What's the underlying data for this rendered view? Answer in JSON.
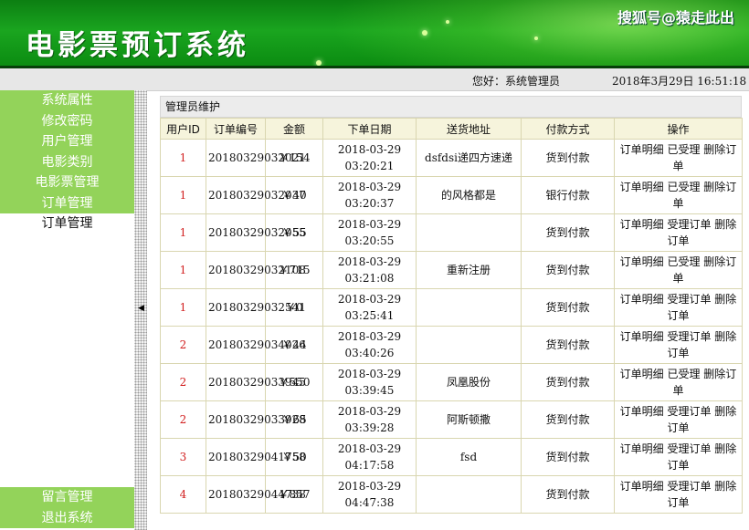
{
  "banner": {
    "title": "电影票预订系统",
    "watermark": "搜狐号@猿走此出"
  },
  "status": {
    "greeting": "您好：系统管理员",
    "datetime": "2018年3月29日 16:51:18"
  },
  "sidebar": {
    "items": [
      {
        "label": "系统属性"
      },
      {
        "label": "修改密码"
      },
      {
        "label": "用户管理"
      },
      {
        "label": "电影类别"
      },
      {
        "label": "电影票管理"
      },
      {
        "label": "订单管理"
      },
      {
        "label": "订单管理"
      }
    ],
    "bottom_items": [
      {
        "label": "留言管理"
      },
      {
        "label": "退出系统"
      }
    ]
  },
  "main": {
    "section_title": "管理员维护",
    "columns": [
      "用户ID",
      "订单编号",
      "金额",
      "下单日期",
      "送货地址",
      "付款方式",
      "操作"
    ],
    "rows": [
      {
        "uid": "1",
        "order_no": "20180329032021",
        "amount": "￥154",
        "date": "2018-03-29 03:20:21",
        "address": "dsfdsi递四方速递",
        "payment": "货到付款",
        "ops": "订单明细 已受理 删除订单"
      },
      {
        "uid": "1",
        "order_no": "20180329032037",
        "amount": "￥40",
        "date": "2018-03-29 03:20:37",
        "address": "的风格都是",
        "payment": "银行付款",
        "ops": "订单明细 已受理 删除订单"
      },
      {
        "uid": "1",
        "order_no": "20180329032055",
        "amount": "￥55",
        "date": "2018-03-29 03:20:55",
        "address": "",
        "payment": "货到付款",
        "ops": "订单明细 受理订单 删除订单"
      },
      {
        "uid": "1",
        "order_no": "20180329032108",
        "amount": "￥715",
        "date": "2018-03-29 03:21:08",
        "address": "重新注册",
        "payment": "货到付款",
        "ops": "订单明细 已受理 删除订单"
      },
      {
        "uid": "1",
        "order_no": "20180329032541",
        "amount": "￥0",
        "date": "2018-03-29 03:25:41",
        "address": "",
        "payment": "货到付款",
        "ops": "订单明细 受理订单 删除订单"
      },
      {
        "uid": "2",
        "order_no": "20180329034026",
        "amount": "￥44",
        "date": "2018-03-29 03:40:26",
        "address": "",
        "payment": "货到付款",
        "ops": "订单明细 受理订单 删除订单"
      },
      {
        "uid": "2",
        "order_no": "20180329033945",
        "amount": "￥550",
        "date": "2018-03-29 03:39:45",
        "address": "凤凰股份",
        "payment": "货到付款",
        "ops": "订单明细 已受理 删除订单"
      },
      {
        "uid": "2",
        "order_no": "20180329033928",
        "amount": "￥65",
        "date": "2018-03-29 03:39:28",
        "address": "阿斯顿撒",
        "payment": "货到付款",
        "ops": "订单明细 受理订单 删除订单"
      },
      {
        "uid": "3",
        "order_no": "20180329041758",
        "amount": "￥50",
        "date": "2018-03-29 04:17:58",
        "address": "fsd",
        "payment": "货到付款",
        "ops": "订单明细 受理订单 删除订单"
      },
      {
        "uid": "4",
        "order_no": "20180329044738",
        "amount": "￥857",
        "date": "2018-03-29 04:47:38",
        "address": "",
        "payment": "货到付款",
        "ops": "订单明细 受理订单 删除订单"
      }
    ]
  },
  "colors": {
    "banner_green": "#1aa51f",
    "menu_green": "#93d35a",
    "uid_red": "#d22020",
    "header_cream": "#f6f4dc"
  }
}
